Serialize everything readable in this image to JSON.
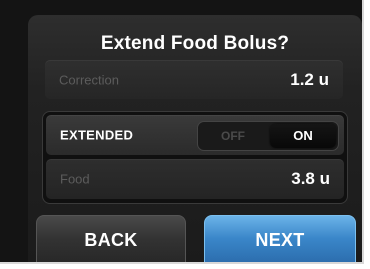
{
  "dialog": {
    "title": "Extend Food Bolus?"
  },
  "correction": {
    "label": "Correction",
    "value": "1.2 u"
  },
  "extended": {
    "label": "EXTENDED",
    "toggle_off_label": "OFF",
    "toggle_on_label": "ON",
    "state": "ON"
  },
  "food": {
    "label": "Food",
    "value": "3.8 u"
  },
  "buttons": {
    "back_label": "BACK",
    "next_label": "NEXT"
  },
  "colors": {
    "next_accent": "#3a86c9",
    "background": "#1b1b1b"
  }
}
